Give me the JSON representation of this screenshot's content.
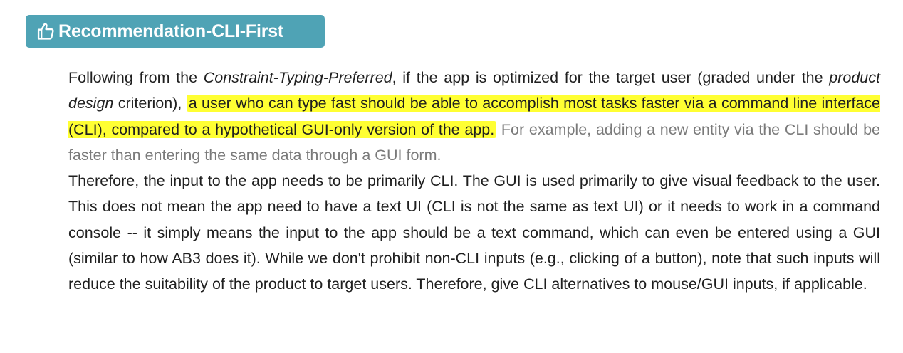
{
  "header": {
    "icon": "thumbs-up-icon",
    "title": "Recommendation-CLI-First",
    "color": "#4fa3b5"
  },
  "paragraph1": {
    "p1": "Following from the ",
    "p1_em": "Constraint-Typing-Preferred",
    "p2": ", if the app is optimized for the target user (graded under the ",
    "p2_em": "product design",
    "p3": " criterion), ",
    "highlight": "a user who can type fast should be able to accomplish most tasks faster via a command line interface (CLI), compared to a hypothetical GUI-only version of the app.",
    "example": "For example, adding a new entity via the CLI should be faster than entering the same data through a GUI form."
  },
  "paragraph2": {
    "text": "Therefore, the input to the app needs to be primarily CLI. The GUI is used primarily to give visual feedback to the user. This does not mean the app need to have a text UI (CLI is not the same as text UI) or it needs to work in a command console -- it simply means the input to the app should be a text command, which can even be entered using a GUI (similar to how AB3 does it). While we don't prohibit non-CLI inputs (e.g., clicking of a button), note that such inputs will reduce the suitability of the product to target users. Therefore, give CLI alternatives to mouse/GUI inputs, if applicable."
  },
  "colors": {
    "highlight": "#ffff33",
    "muted_text": "#7a7a7a"
  }
}
